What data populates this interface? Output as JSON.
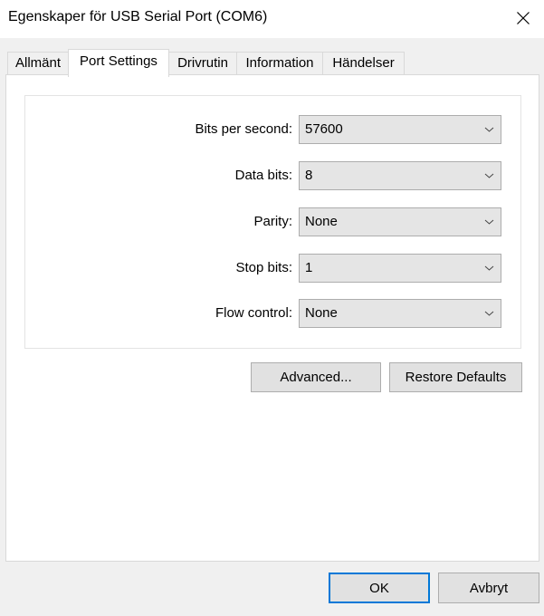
{
  "window": {
    "title": "Egenskaper för USB Serial Port (COM6)"
  },
  "tabs": [
    {
      "label": "Allmänt"
    },
    {
      "label": "Port Settings",
      "selected": true
    },
    {
      "label": "Drivrutin"
    },
    {
      "label": "Information"
    },
    {
      "label": "Händelser"
    }
  ],
  "port_settings": {
    "fields": [
      {
        "label": "Bits per second:",
        "value": "57600"
      },
      {
        "label": "Data bits:",
        "value": "8"
      },
      {
        "label": "Parity:",
        "value": "None"
      },
      {
        "label": "Stop bits:",
        "value": "1"
      },
      {
        "label": "Flow control:",
        "value": "None"
      }
    ],
    "advanced_label": "Advanced...",
    "restore_label": "Restore Defaults"
  },
  "footer": {
    "ok_label": "OK",
    "cancel_label": "Avbryt"
  },
  "colors": {
    "accent": "#0078d7",
    "button_face": "#e1e1e1",
    "combo_face": "#e5e5e5"
  },
  "icons": {
    "close": "close-icon",
    "dropdown": "chevron-down-icon"
  }
}
